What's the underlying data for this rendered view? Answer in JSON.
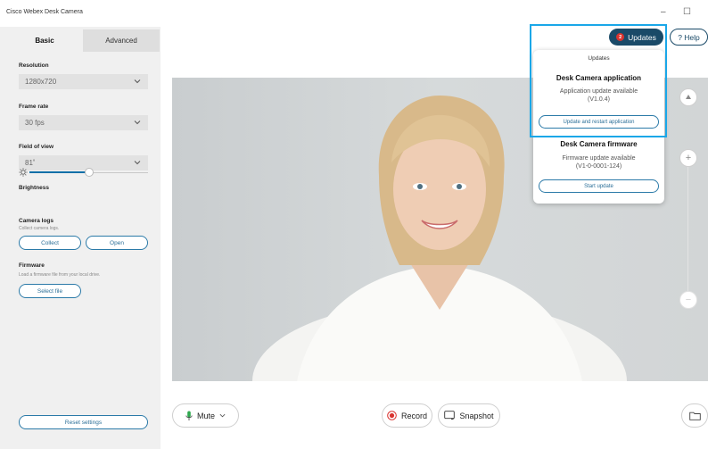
{
  "app": {
    "title": "Cisco Webex Desk Camera"
  },
  "window": {
    "minimize": "–",
    "maximize": "☐"
  },
  "tabs": {
    "basic": "Basic",
    "advanced": "Advanced"
  },
  "settings": {
    "resolution": {
      "label": "Resolution",
      "value": "1280x720"
    },
    "frame_rate": {
      "label": "Frame rate",
      "value": "30 fps"
    },
    "field_of_view": {
      "label": "Field of view",
      "value": "81˚"
    },
    "brightness": {
      "label": "Brightness",
      "level": 0.5
    },
    "camera_logs": {
      "label": "Camera logs",
      "sub": "Collect camera logs.",
      "collect": "Collect",
      "open": "Open"
    },
    "firmware": {
      "label": "Firmware",
      "sub": "Load a firmware file from your local drive.",
      "select": "Select file"
    },
    "reset": "Reset settings"
  },
  "header": {
    "updates": "Updates",
    "updates_count": "2",
    "help": "Help"
  },
  "popover": {
    "title": "Updates",
    "app_heading": "Desk Camera application",
    "app_text_1": "Application update available",
    "app_text_2": "(V1.0.4)",
    "app_button": "Update and restart application",
    "fw_heading": "Desk Camera firmware",
    "fw_text_1": "Firmware update available",
    "fw_text_2": "(V1-0-0001-124)",
    "fw_button": "Start update"
  },
  "controls": {
    "mute": "Mute",
    "record": "Record",
    "snapshot": "Snapshot",
    "zoom_in": "+",
    "zoom_out": "−"
  },
  "colors": {
    "accent": "#1a4a68",
    "link": "#2b7aa8",
    "badge": "#d9332f",
    "record": "#d9332f",
    "highlight": "#1aa7e8"
  }
}
